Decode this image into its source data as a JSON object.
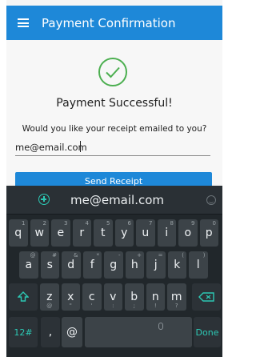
{
  "appbar": {
    "title": "Payment Confirmation"
  },
  "content": {
    "success_text": "Payment Successful!",
    "question_text": "Would you like your receipt emailed to you?",
    "email_value": "me@email.com",
    "send_label": "Send Receipt"
  },
  "keyboard": {
    "suggestion": "me@email.com",
    "row1": [
      {
        "k": "q",
        "h": "1"
      },
      {
        "k": "w",
        "h": "2"
      },
      {
        "k": "e",
        "h": "3"
      },
      {
        "k": "r",
        "h": "4"
      },
      {
        "k": "t",
        "h": "5"
      },
      {
        "k": "y",
        "h": "6"
      },
      {
        "k": "u",
        "h": "7"
      },
      {
        "k": "i",
        "h": "8"
      },
      {
        "k": "o",
        "h": "9"
      },
      {
        "k": "p",
        "h": "0"
      }
    ],
    "row2": [
      {
        "k": "a",
        "h": "@"
      },
      {
        "k": "s",
        "h": "#"
      },
      {
        "k": "d",
        "h": "&"
      },
      {
        "k": "f",
        "h": "*"
      },
      {
        "k": "g",
        "h": "-"
      },
      {
        "k": "h",
        "h": "+"
      },
      {
        "k": "j",
        "h": "="
      },
      {
        "k": "k",
        "h": "("
      },
      {
        "k": "l",
        "h": ")"
      }
    ],
    "row3": [
      {
        "k": "z",
        "h": "@"
      },
      {
        "k": "x",
        "h": "\""
      },
      {
        "k": "c",
        "h": "'"
      },
      {
        "k": "v",
        "h": ":"
      },
      {
        "k": "b",
        "h": ";"
      },
      {
        "k": "n",
        "h": "!"
      },
      {
        "k": "m",
        "h": "?"
      }
    ],
    "numbers_label": "12#",
    "comma_label": ",",
    "at_label": "@",
    "period_label": ".",
    "done_label": "Done"
  },
  "colors": {
    "accent": "#1e88d8",
    "success": "#4caf50",
    "keyboard_accent": "#2cc8b4"
  }
}
